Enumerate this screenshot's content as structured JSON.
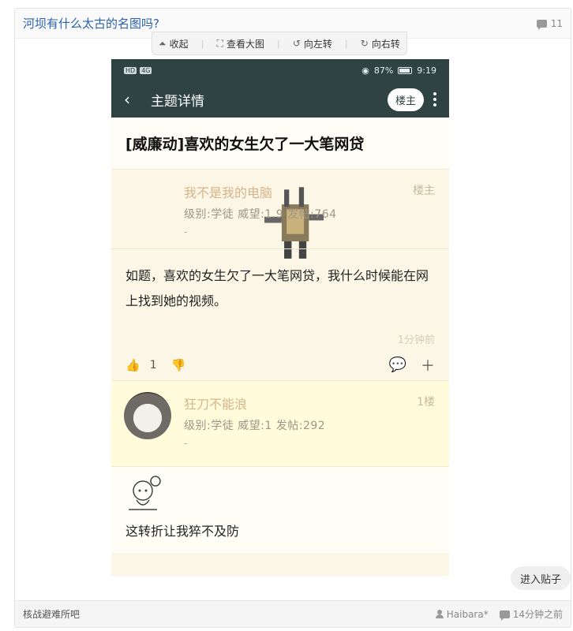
{
  "thread": {
    "title": "河坝有什么太古的名图吗?",
    "reply_count": "11",
    "forum_name": "核战避难所吧",
    "author": "Haibara*",
    "time": "14分钟之前",
    "enter_label": "进入贴子"
  },
  "toolbar": {
    "collapse": "收起",
    "view_large": "查看大图",
    "rotate_left": "向左转",
    "rotate_right": "向右转"
  },
  "embedded": {
    "status": {
      "signal": "4G",
      "battery": "87%",
      "clock": "9:19"
    },
    "nav_title": "主题详情",
    "owner_button": "楼主",
    "topic_title": "[威廉动]喜欢的女生欠了一大笔网贷",
    "post1": {
      "username": "我不是我的电脑",
      "floor": "楼主",
      "meta": "级别:学徒   威望:1.9   发帖:764",
      "dash": "-",
      "body": "如题，喜欢的女生欠了一大笔网贷，我什么时候能在网上找到她的视频。",
      "time": "1分钟前",
      "likes": "1"
    },
    "post2": {
      "username": "狂刀不能浪",
      "floor": "1楼",
      "meta": "级别:学徒   威望:1   发帖:292",
      "dash": "-",
      "body": "这转折让我猝不及防"
    }
  },
  "icons": {
    "reply": "comment-icon",
    "user": "user-icon",
    "time": "clock-icon"
  }
}
